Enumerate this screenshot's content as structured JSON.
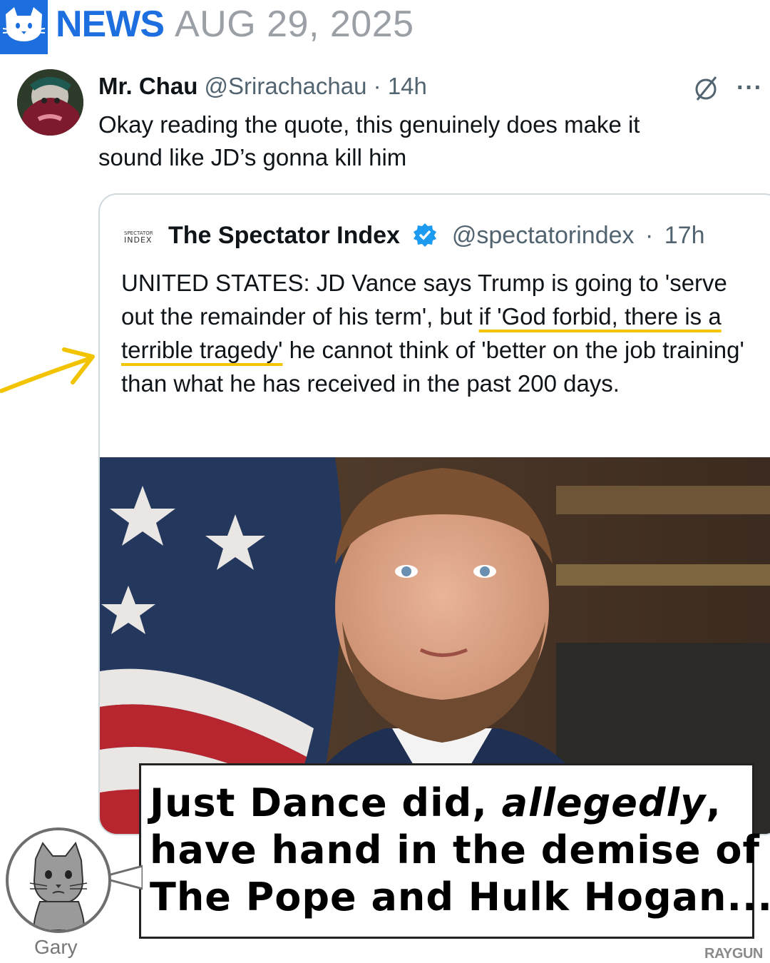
{
  "header": {
    "brand_icon": "cat-icon",
    "news_label": "NEWS",
    "date": "AUG 29, 2025",
    "accent_color": "#1d6fe0"
  },
  "post": {
    "author": "Mr. Chau",
    "handle": "@Srirachachau",
    "separator": "·",
    "time": "14h",
    "text_line1": "Okay reading the quote, this genuinely does make it",
    "text_line2": "sound like JD’s gonna kill him",
    "grok_icon": "slash-circle-icon",
    "more_icon": "more-options-icon",
    "more_label": "···"
  },
  "quote": {
    "logo_top": "SPECTATOR",
    "logo_bottom": "INDEX",
    "author": "The Spectator Index",
    "verified_icon": "verified-badge-icon",
    "handle": "@spectatorindex",
    "separator": "·",
    "time": "17h",
    "text_part1": "UNITED STATES: JD Vance says Trump is going to 'serve out the remainder of his term', but ",
    "text_highlight": "if 'God forbid, there is a terrible tragedy'",
    "text_part2": " he cannot think of 'better on the job training' than what he has received in the past 200 days.",
    "highlight_color": "#f5c400"
  },
  "caption": {
    "line1_prefix": "Just Dance did, ",
    "line1_emph": "allegedly",
    "line1_suffix": ",",
    "line2": "have hand in the demise of",
    "line3": "The Pope and Hulk Hogan..."
  },
  "gary": {
    "name": "Gary",
    "icon": "cat-avatar-icon"
  },
  "watermark": "RAYGUN"
}
